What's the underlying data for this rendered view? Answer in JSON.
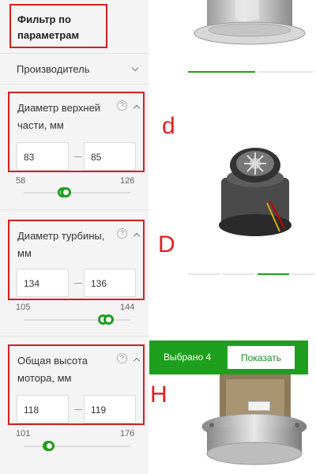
{
  "sidebar": {
    "title": "Фильтр по параметрам",
    "manufacturer_label": "Производитель",
    "filters": [
      {
        "label": "Диаметр верхней части, мм",
        "help": "?",
        "from": "83",
        "to": "85",
        "range_min": "58",
        "range_max": "126",
        "selected_from_value": 83,
        "selected_to_value": 85
      },
      {
        "label": "Диаметр турбины, мм",
        "help": "?",
        "from": "134",
        "to": "136",
        "range_min": "105",
        "range_max": "144",
        "selected_from_value": 134,
        "selected_to_value": 136
      },
      {
        "label": "Общая высота мотора, мм",
        "help": "?",
        "from": "118",
        "to": "119",
        "range_min": "101",
        "range_max": "176",
        "selected_from_value": 118,
        "selected_to_value": 119
      }
    ]
  },
  "selection_bar": {
    "selected_text": "Выбрано 4",
    "show_label": "Показать"
  },
  "annotations": [
    "d",
    "D",
    "H"
  ],
  "colors": {
    "accent_green": "#1ea01e",
    "highlight_red": "#d32020",
    "sidebar_bg": "#f4f4f4"
  }
}
